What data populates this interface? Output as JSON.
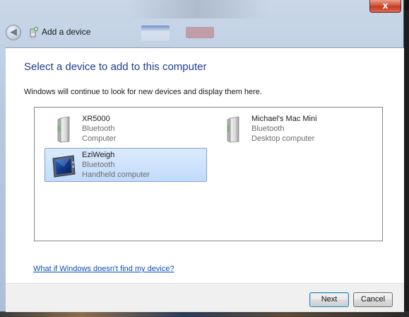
{
  "window": {
    "title": "Add a device",
    "close_label": "x"
  },
  "header": {
    "back_label": "◀"
  },
  "main": {
    "heading": "Select a device to add to this computer",
    "subtext": "Windows will continue to look for new devices and display them here."
  },
  "devices": [
    {
      "name": "XR5000",
      "connection": "Bluetooth",
      "category": "Computer",
      "icon": "computer-tower-icon",
      "selected": false
    },
    {
      "name": "Michael's Mac Mini",
      "connection": "Bluetooth",
      "category": "Desktop computer",
      "icon": "computer-tower-icon",
      "selected": false
    },
    {
      "name": "EziWeigh",
      "connection": "Bluetooth",
      "category": "Handheld computer",
      "icon": "handheld-computer-icon",
      "selected": true
    }
  ],
  "help_link": "What if Windows doesn't find my device?",
  "footer": {
    "next_label": "Next",
    "cancel_label": "Cancel"
  },
  "colors": {
    "heading": "#1e3d8f",
    "link": "#0b50b8",
    "selection": "#c1dbfc",
    "close": "#c43b24"
  }
}
